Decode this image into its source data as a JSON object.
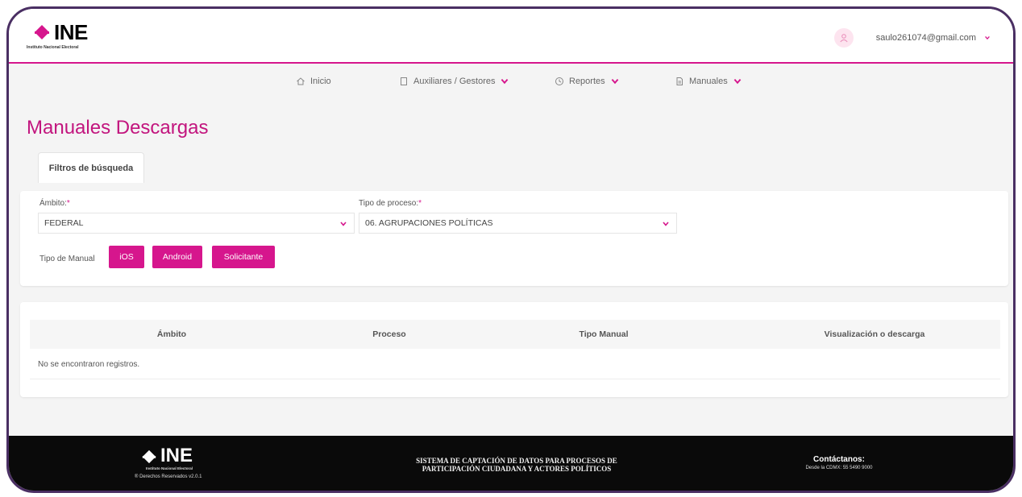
{
  "header": {
    "logo_text": "INE",
    "logo_subtitle": "Instituto Nacional Electoral",
    "user_email": "saulo261074@gmail.com"
  },
  "nav": {
    "items": [
      {
        "label": "Inicio",
        "icon": "home-icon"
      },
      {
        "label": "Auxiliares / Gestores",
        "icon": "document-icon"
      },
      {
        "label": "Reportes",
        "icon": "clock-icon"
      },
      {
        "label": "Manuales",
        "icon": "file-icon"
      }
    ]
  },
  "page": {
    "title": "Manuales Descargas"
  },
  "filters": {
    "tab_label": "Filtros de búsqueda",
    "ambito_label": "Ámbito:",
    "ambito_value": "FEDERAL",
    "tipo_proceso_label": "Tipo de proceso:",
    "tipo_proceso_value": "06. AGRUPACIONES POLÍTICAS",
    "required_mark": "*",
    "tipo_manual_label": "Tipo de Manual",
    "buttons": [
      "iOS",
      "Android",
      "Solicitante"
    ]
  },
  "table": {
    "columns": [
      "Ámbito",
      "Proceso",
      "Tipo Manual",
      "Visualización o descarga"
    ],
    "empty_message": "No se encontraron registros."
  },
  "footer": {
    "logo_text": "INE",
    "logo_subtitle": "Instituto Nacional Electoral",
    "rights": "® Derechos Reservados v2.0.1",
    "system_line1": "SISTEMA DE CAPTACIÓN DE DATOS PARA PROCESOS DE",
    "system_line2": "PARTICIPACIÓN CIUDADANA Y ACTORES POLÍTICOS",
    "contact_title": "Contáctanos:",
    "contact_phone": "Desde la CDMX: 55 5490 9000"
  },
  "colors": {
    "accent": "#d6168d",
    "title": "#c2157e",
    "frame": "#4a2f63",
    "footer_bg": "#0a0a0a"
  }
}
